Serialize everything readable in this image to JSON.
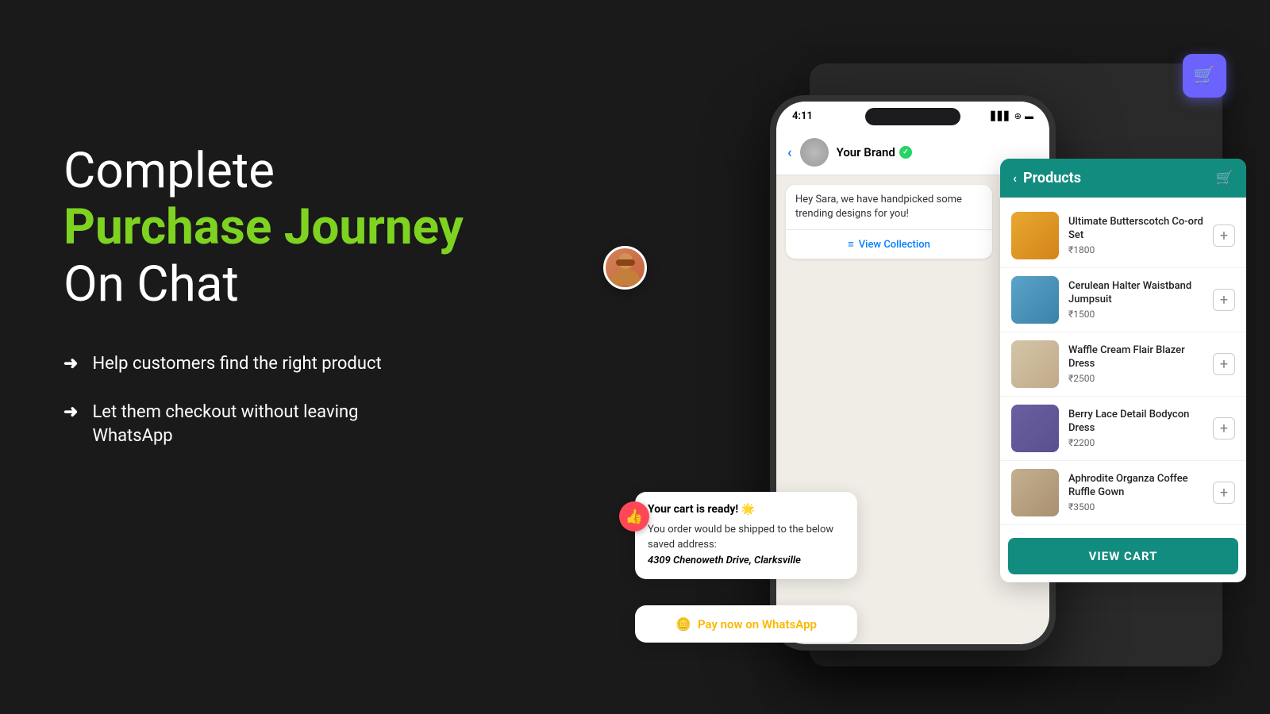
{
  "page": {
    "background": "#1a1a1a"
  },
  "hero": {
    "line1": "Complete",
    "line2": "Purchase Journey",
    "line3": "On Chat",
    "features": [
      {
        "text": "Help customers find the right product"
      },
      {
        "text": "Let them checkout without leaving WhatsApp"
      }
    ]
  },
  "phone": {
    "status_time": "4:11",
    "status_icons": "▲ ⬡ 🔋",
    "header": {
      "brand_name": "Your Brand",
      "verified": true
    },
    "chat_bubble": {
      "text": "Hey Sara, we have handpicked some trending designs for you!",
      "cta": "View Collection"
    }
  },
  "products_panel": {
    "title": "Products",
    "back_label": "<",
    "cart_label": "🛒",
    "items": [
      {
        "name": "Ultimate Butterscotch Co-ord Set",
        "price": "₹1800",
        "color_class": "prod-1-bg"
      },
      {
        "name": "Cerulean Halter Waistband Jumpsuit",
        "price": "₹1500",
        "color_class": "prod-2-bg"
      },
      {
        "name": "Waffle Cream Flair Blazer Dress",
        "price": "₹2500",
        "color_class": "prod-3-bg"
      },
      {
        "name": "Berry Lace Detail Bodycon Dress",
        "price": "₹2200",
        "color_class": "prod-4-bg"
      },
      {
        "name": "Aphrodite Organza Coffee Ruffle Gown",
        "price": "₹3500",
        "color_class": "prod-5-bg"
      }
    ],
    "view_cart_label": "VIEW CART"
  },
  "cart_bubble": {
    "title": "Your cart is ready! 🌟",
    "text": "You order would be shipped to the below saved address:",
    "address": "4309 Chenoweth Drive, Clarksville"
  },
  "pay_bubble": {
    "text": "Pay now on WhatsApp"
  }
}
